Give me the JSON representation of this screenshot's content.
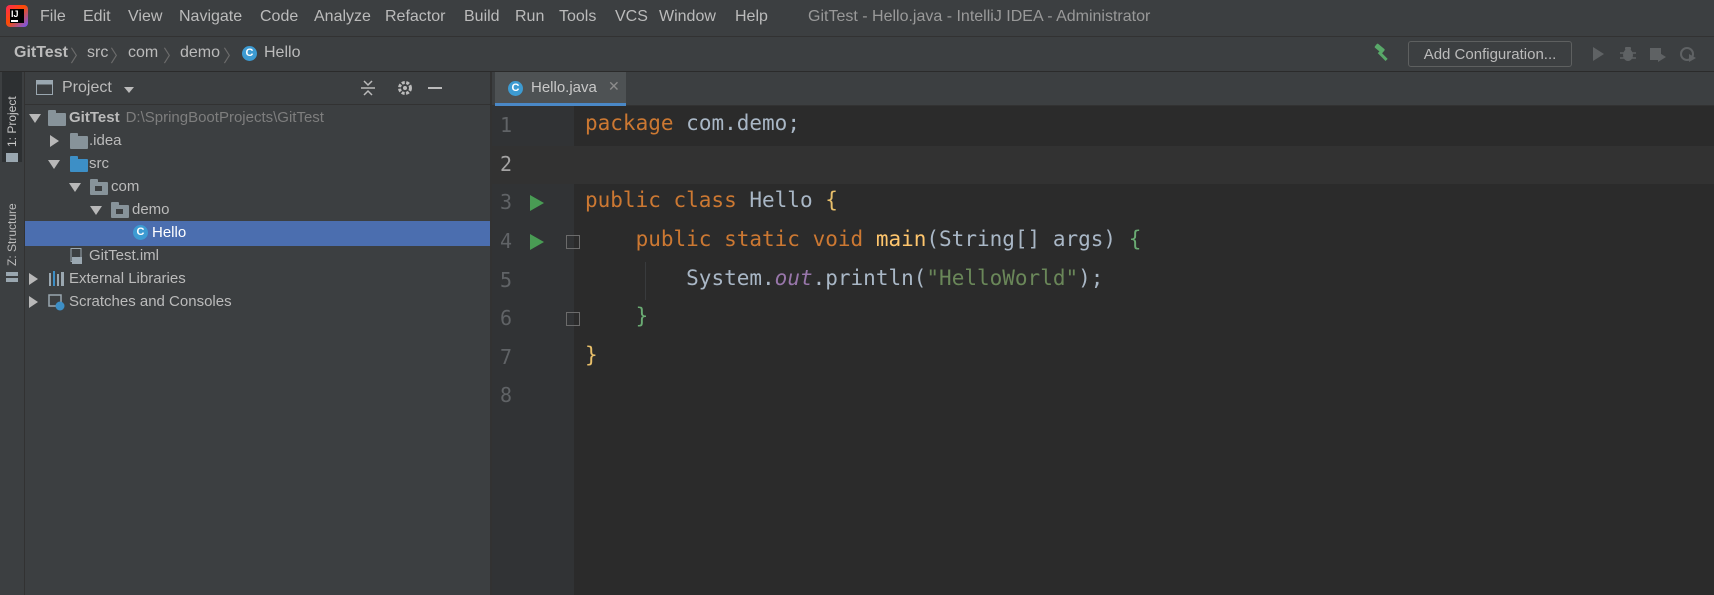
{
  "menubar": {
    "items": [
      "File",
      "Edit",
      "View",
      "Navigate",
      "Code",
      "Analyze",
      "Refactor",
      "Build",
      "Run",
      "Tools",
      "VCS",
      "Window",
      "Help"
    ],
    "window_title": "GitTest - Hello.java - IntelliJ IDEA - Administrator"
  },
  "navbar": {
    "breadcrumbs": [
      "GitTest",
      "src",
      "com",
      "demo",
      "Hello"
    ],
    "add_configuration": "Add Configuration..."
  },
  "left_strip": {
    "project_tab": "1: Project",
    "structure_tab": "Z: Structure"
  },
  "project_panel": {
    "title": "Project",
    "tree": [
      {
        "label": "GitTest",
        "path": "D:\\SpringBootProjects\\GitTest",
        "icon": "module-folder-icon"
      },
      {
        "label": ".idea",
        "icon": "folder-icon"
      },
      {
        "label": "src",
        "icon": "source-folder-icon"
      },
      {
        "label": "com",
        "icon": "package-icon"
      },
      {
        "label": "demo",
        "icon": "package-icon"
      },
      {
        "label": "Hello",
        "icon": "java-class-icon"
      },
      {
        "label": "GitTest.iml",
        "icon": "iml-file-icon"
      },
      {
        "label": "External Libraries",
        "icon": "libraries-icon"
      },
      {
        "label": "Scratches and Consoles",
        "icon": "scratches-icon"
      }
    ]
  },
  "editor": {
    "tab_label": "Hello.java",
    "line_numbers": [
      "1",
      "2",
      "3",
      "4",
      "5",
      "6",
      "7",
      "8"
    ],
    "code": {
      "l1_kw": "package",
      "l1_rest": "com.demo;",
      "l3_kw": "public class",
      "l3_name": "Hello",
      "l3_brace": "{",
      "l4_kw": "public static void",
      "l4_fn": "main",
      "l4_params": "(String[] args)",
      "l4_brace": "{",
      "l5_obj": "System.",
      "l5_field": "out",
      "l5_call": ".println(",
      "l5_str": "\"HelloWorld\"",
      "l5_end": ");",
      "l6_brace": "}",
      "l7_brace": "}"
    }
  },
  "colors": {
    "keyword": "#cc7832",
    "string": "#6a8759",
    "method": "#ffc66d",
    "field": "#9876aa",
    "selection": "#4b6eaf",
    "run_gutter": "#499c54"
  }
}
